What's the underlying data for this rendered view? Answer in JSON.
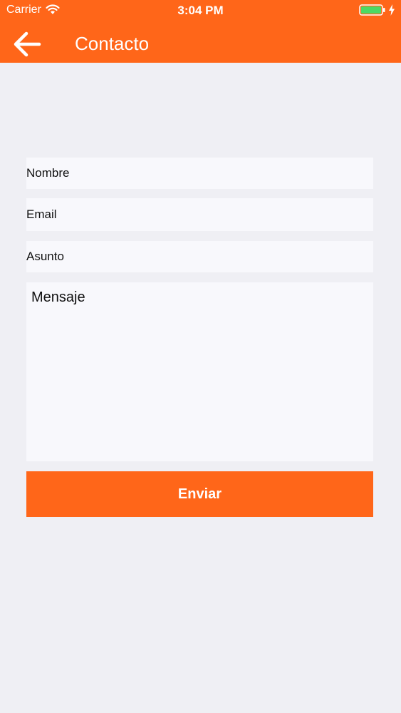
{
  "status_bar": {
    "carrier": "Carrier",
    "time": "3:04 PM",
    "wifi_icon": "wifi-icon",
    "battery_icon": "battery-icon",
    "charging_icon": "bolt-icon",
    "battery_color": "#4cd964"
  },
  "nav": {
    "back_icon": "arrow-left-icon",
    "title": "Contacto"
  },
  "form": {
    "nombre_placeholder": "Nombre",
    "email_placeholder": "Email",
    "asunto_placeholder": "Asunto",
    "mensaje_placeholder": "Mensaje",
    "submit_label": "Enviar"
  },
  "colors": {
    "accent": "#ff6619",
    "background": "#efeff4",
    "field_background": "#f8f8fc"
  }
}
